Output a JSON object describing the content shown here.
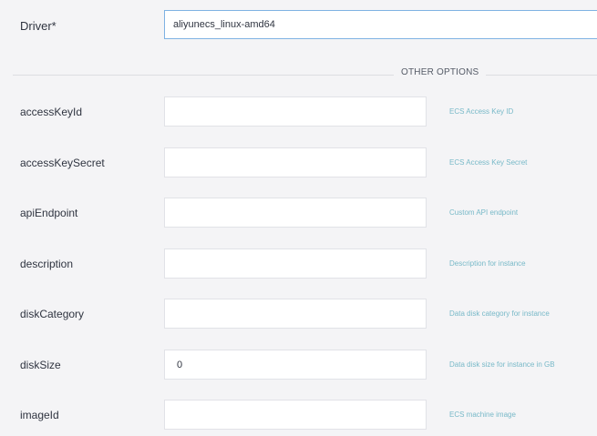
{
  "driver": {
    "label": "Driver*",
    "value": "aliyunecs_linux-amd64"
  },
  "section_title": "OTHER OPTIONS",
  "fields": [
    {
      "label": "accessKeyId",
      "value": "",
      "help": "ECS Access Key ID"
    },
    {
      "label": "accessKeySecret",
      "value": "",
      "help": "ECS Access Key Secret"
    },
    {
      "label": "apiEndpoint",
      "value": "",
      "help": "Custom API endpoint"
    },
    {
      "label": "description",
      "value": "",
      "help": "Description for instance"
    },
    {
      "label": "diskCategory",
      "value": "",
      "help": "Data disk category for instance"
    },
    {
      "label": "diskSize",
      "value": "0",
      "help": "Data disk size for instance in GB"
    },
    {
      "label": "imageId",
      "value": "",
      "help": "ECS machine image"
    }
  ]
}
